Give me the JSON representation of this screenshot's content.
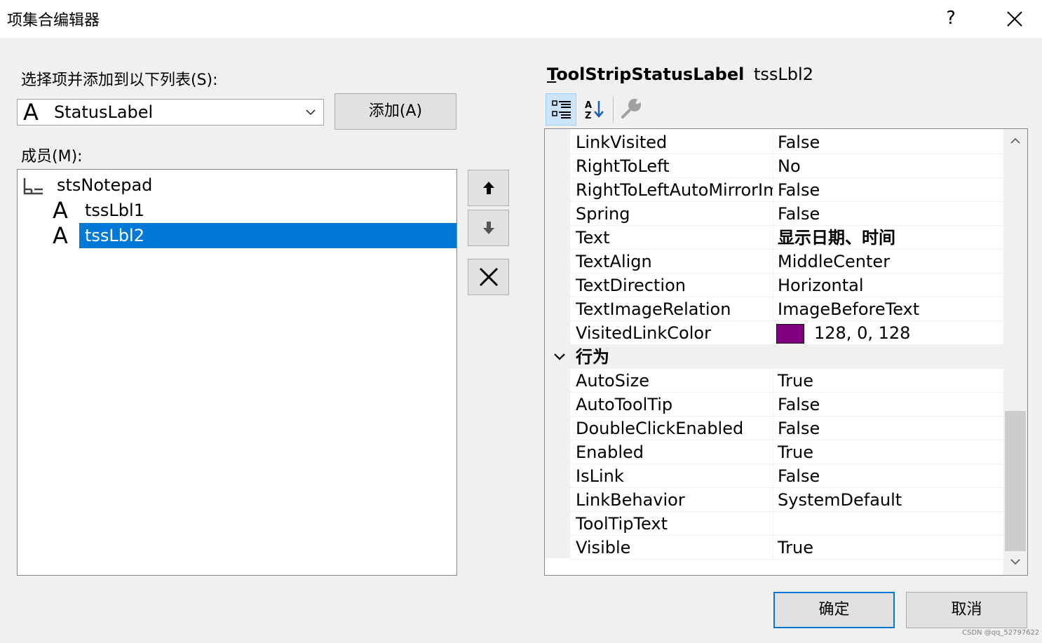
{
  "window": {
    "title": "项集合编辑器",
    "help_label": "?"
  },
  "left": {
    "select_label": "选择项并添加到以下列表(S):",
    "combo_value": "StatusLabel",
    "add_button": "添加(A)",
    "members_label": "成员(M):",
    "members": [
      {
        "glyph": "",
        "label": "stsNotepad"
      },
      {
        "glyph": "A",
        "label": "tssLbl1"
      },
      {
        "glyph": "A",
        "label": "tssLbl2"
      }
    ],
    "combo_glyph": "A"
  },
  "right": {
    "type_name": "ToolStripStatusLabel",
    "type_name_mnemonic": "T",
    "type_name_rest": "oolStripStatusLabel",
    "object_name": "tssLbl2",
    "properties_top": [
      {
        "name": "LinkVisited",
        "value": "False"
      },
      {
        "name": "RightToLeft",
        "value": "No"
      },
      {
        "name": "RightToLeftAutoMirrorIm",
        "value": "False"
      },
      {
        "name": "Spring",
        "value": "False"
      },
      {
        "name": "Text",
        "value": "显示日期、时间"
      },
      {
        "name": "TextAlign",
        "value": "MiddleCenter"
      },
      {
        "name": "TextDirection",
        "value": "Horizontal"
      },
      {
        "name": "TextImageRelation",
        "value": "ImageBeforeText"
      },
      {
        "name": "VisitedLinkColor",
        "value": "128, 0, 128"
      }
    ],
    "category": "行为",
    "properties_behavior": [
      {
        "name": "AutoSize",
        "value": "True"
      },
      {
        "name": "AutoToolTip",
        "value": "False"
      },
      {
        "name": "DoubleClickEnabled",
        "value": "False"
      },
      {
        "name": "Enabled",
        "value": "True"
      },
      {
        "name": "IsLink",
        "value": "False"
      },
      {
        "name": "LinkBehavior",
        "value": "SystemDefault"
      },
      {
        "name": "ToolTipText",
        "value": ""
      },
      {
        "name": "Visible",
        "value": "True"
      }
    ],
    "visited_link_color": "#800080"
  },
  "footer": {
    "ok_button": "确定",
    "cancel_button": "取消",
    "watermark": "CSDN @qq_52797622"
  },
  "icons": {
    "close": "close-icon",
    "move_up": "arrow-up-icon",
    "move_down": "arrow-down-icon",
    "remove": "delete-icon",
    "categorized": "categorized-icon",
    "alphabetical": "sort-alphabetical-icon",
    "property_pages": "wrench-icon",
    "toolstrip": "statusstrip-icon",
    "label": "label-icon"
  },
  "colors": {
    "selection": "#0078d7",
    "button_face": "#e1e1e1",
    "default_button_border": "#0078d7"
  }
}
